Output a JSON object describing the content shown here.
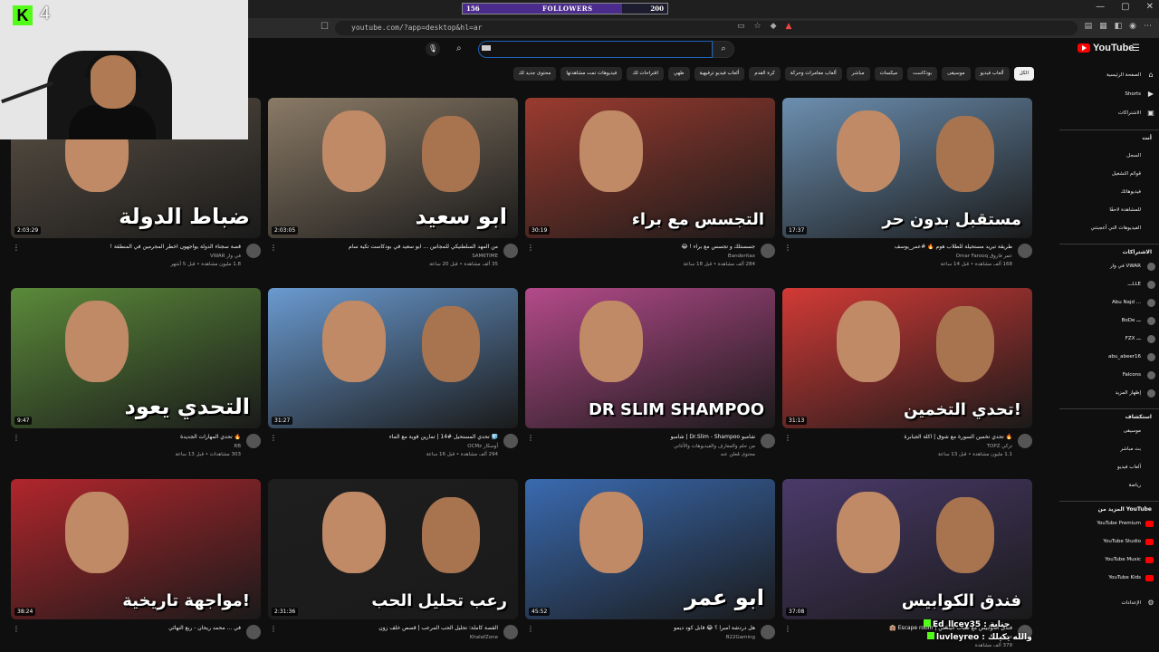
{
  "stream": {
    "kick_number": "4",
    "followers": {
      "current": "156",
      "label": "FOLLOWERS",
      "goal": "200",
      "progress": 0.78
    }
  },
  "browser": {
    "url": "youtube.com/?app=desktop&hl=ar",
    "colors": {
      "chrome": "#1f1f1f",
      "accent": "#ff0000"
    }
  },
  "youtube": {
    "logo_text": "YouTube",
    "search": {
      "value": "",
      "placeholder": "بحث"
    },
    "chips": [
      "الكل",
      "ألعاب فيديو",
      "موسيقى",
      "بودكاست",
      "ميكسات",
      "مباشر",
      "ألعاب مغامرات وحركة",
      "كرة القدم",
      "ألعاب فيديو ترفيهية",
      "طهي",
      "اقتراحات لك",
      "فيديوهات تمت مشاهدتها",
      "محتوى جديد لك"
    ],
    "sidebar": {
      "main": [
        {
          "label": "الصفحة الرئيسية",
          "icon": "home-icon"
        },
        {
          "label": "Shorts",
          "icon": "shorts-icon"
        },
        {
          "label": "الاشتراكات",
          "icon": "subscriptions-icon"
        }
      ],
      "you_header": "أنت",
      "you": [
        "السجل",
        "قوائم التشغيل",
        "فيديوهاتك",
        "للمشاهدة لاحقًا",
        "الفيديوهات التي أعجبتني"
      ],
      "subs_header": "الاشتراكات",
      "subs": [
        "في وار VWAR",
        "ـــLLE",
        "Abu Najd ...",
        "BoDe ـــ",
        "FZX ـــ",
        "abu_abeer16",
        "Falcons",
        "إظهار المزيد"
      ],
      "explore_header": "استكشاف",
      "explore": [
        "موسيقى",
        "بث مباشر",
        "ألعاب فيديو",
        "رياضة"
      ],
      "more_header": "المزيد من YouTube",
      "more": [
        "YouTube Premium",
        "YouTube Studio",
        "YouTube Music",
        "YouTube Kids"
      ],
      "settings": "الإعدادات"
    },
    "videos": [
      {
        "title": "طريقة تبريد مستحيلة للطلاب هوم 🔥 #عمر_يوسف",
        "channel": "عمر فاروق Omar Farooq",
        "stats": "168 ألف مشاهدة • قبل 14 ساعة",
        "duration": "17:37",
        "thumb_text": "مستقبل بدون حر",
        "bg": "#6c8fb0"
      },
      {
        "title": "جسستلك و تجسس مع براء ! 😂",
        "channel": "Banderitax",
        "stats": "284 ألف مشاهدة • قبل 18 ساعة",
        "duration": "30:19",
        "thumb_text": "التجسس مع براء",
        "bg": "#9b3b2f"
      },
      {
        "title": "من المهد السلطنيكي للمجانين ... ابو سعيد في بودكاست تكية سام",
        "channel": "SAM6TIME",
        "stats": "35 ألف مشاهدة • قبل 20 ساعة",
        "duration": "2:03:05",
        "thumb_text": "ابو سعيد",
        "bg": "#8a7a66"
      },
      {
        "title": "قصة سجناء الدولة يواجهون اخطر المجرمين في المنطقة !",
        "channel": "في وار VWAR",
        "stats": "1.8 مليون مشاهدة • قبل 5 أشهر",
        "duration": "2:03:29",
        "thumb_text": "ضباط الدولة",
        "bg": "#5a5044"
      },
      {
        "title": "🔥 تحدي تخمين السورة مع شوق | آكلة الجبابرة",
        "channel": "تركي TOPZ",
        "stats": "1.1 مليون مشاهدة • قبل 13 ساعة",
        "duration": "31:13",
        "thumb_text": "تحدي التخمين!",
        "bg": "#d23a36"
      },
      {
        "title": "شامبو Dr.Slim - Shampoo | شامبو",
        "channel": "من حلم والمعارف والفيديوهات والأغاني",
        "stats": "محتوى مُعلن عنه",
        "duration": "",
        "thumb_text": "DR SLIM SHAMPOO",
        "bg": "#b44a8a"
      },
      {
        "title": "🧊 تحدي المستحيل #14 | تمارين قوية مع الماء",
        "channel": "أوسكار OCMz",
        "stats": "294 ألف مشاهدة • قبل 16 ساعة",
        "duration": "31:27",
        "thumb_text": "",
        "bg": "#6a9ad0"
      },
      {
        "title": "🔥 تحدي المهارات الجديدة",
        "channel": "RB",
        "stats": "303 مشاهدات • قبل 13 ساعة",
        "duration": "9:47",
        "thumb_text": "التحدي يعود",
        "bg": "#5b8a3a"
      },
      {
        "title": "فندق الكوابيس مع شباب ألينكس | Escape room 🏨",
        "channel": "Lynx",
        "stats": "379 ألف مشاهدة",
        "duration": "37:08",
        "thumb_text": "فندق الكوابيس",
        "bg": "#4a3a6a"
      },
      {
        "title": "هل دردشة امبرا ؟ 😂 قابل كود ديمو",
        "channel": "B22Gaming",
        "stats": "",
        "duration": "45:52",
        "thumb_text": "ابو عمر",
        "bg": "#3a6ab0"
      },
      {
        "title": "القصة كاملة: تحليل الحب المرعب | قصص خلف زون",
        "channel": "KhalafZone",
        "stats": "",
        "duration": "2:31:36",
        "thumb_text": "رعب تحليل الحب",
        "bg": "#1e1e1e"
      },
      {
        "title": "في ... محمد ريحان - ربع النهائي",
        "channel": "",
        "stats": "",
        "duration": "38:24",
        "thumb_text": "مواجهة تاريخية!",
        "bg": "#b0262c"
      }
    ]
  },
  "chat": [
    {
      "user": "Ed_llcey35",
      "msg": ": جناية"
    },
    {
      "user": "luvleyreo",
      "msg": ": والله يكيلك"
    }
  ]
}
